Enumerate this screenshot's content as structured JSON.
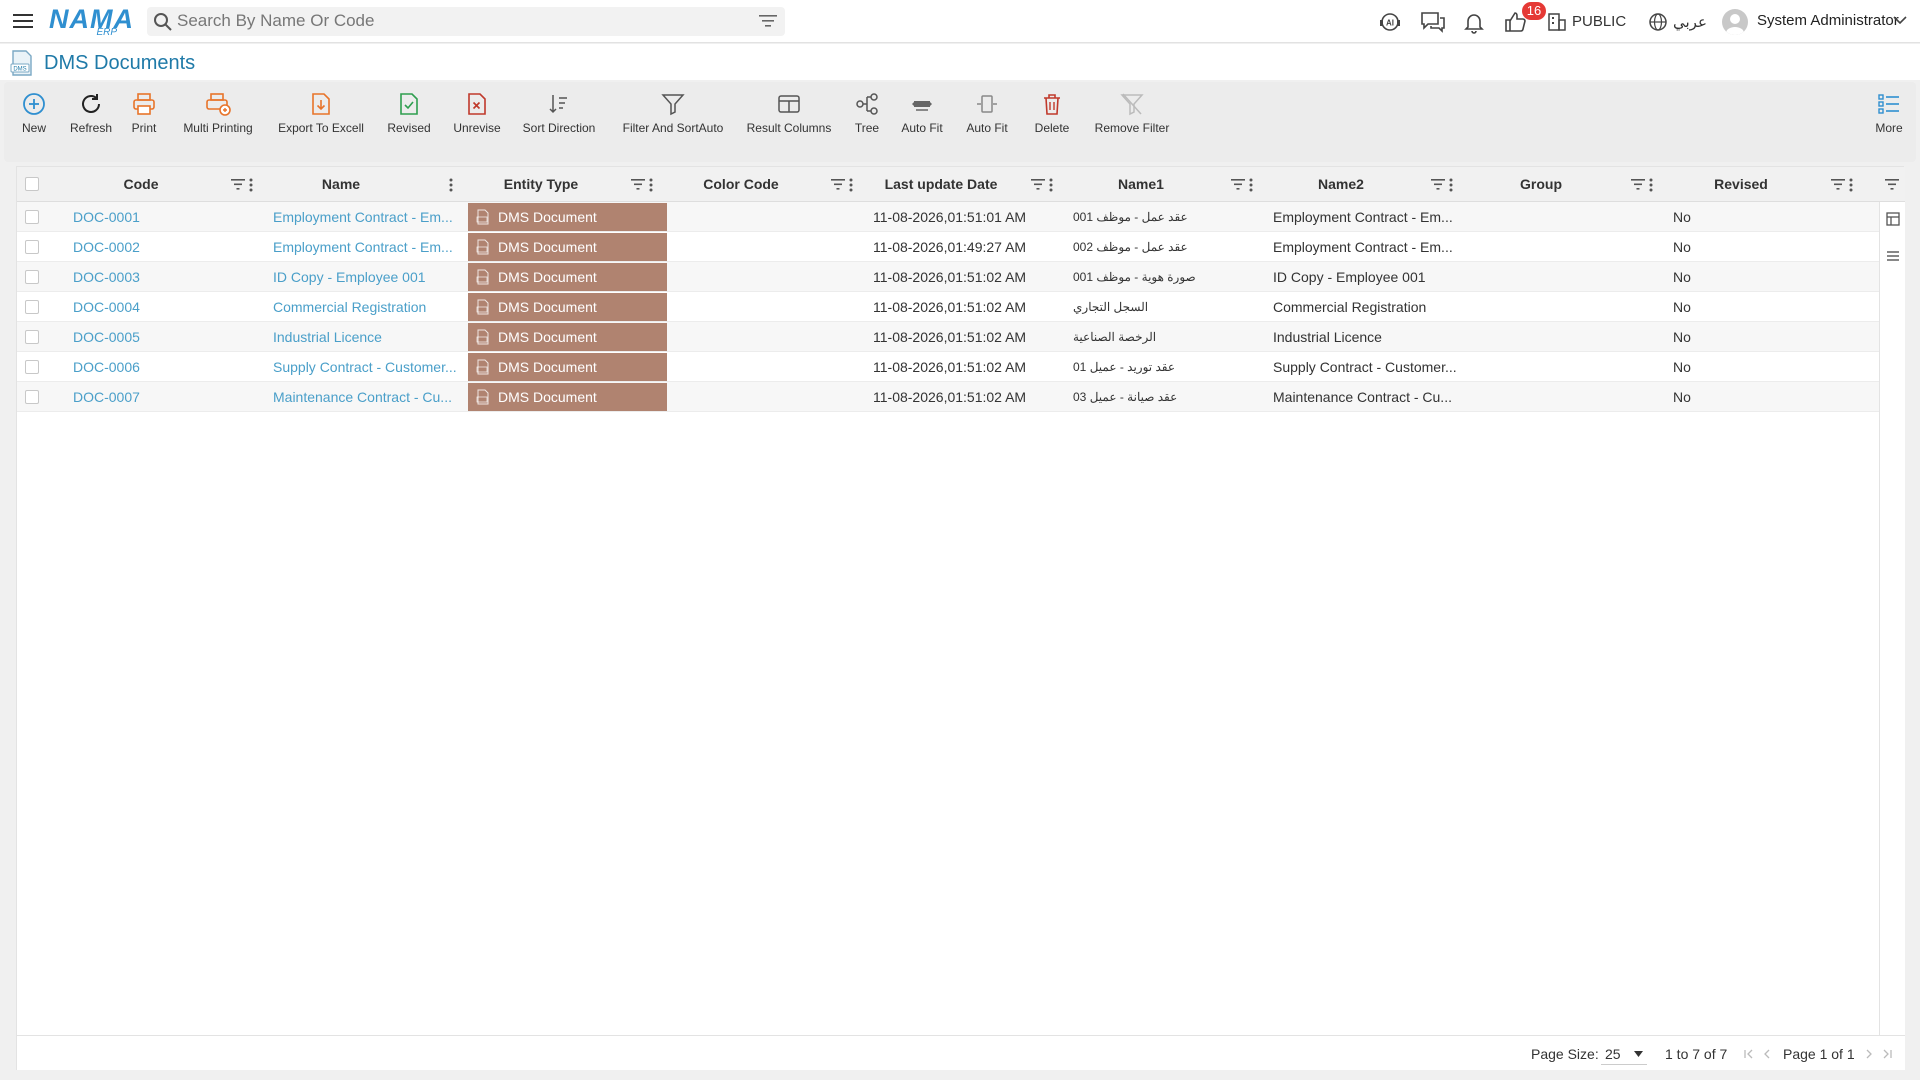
{
  "app": {
    "logo": "NAMA",
    "logo_sub": "ERP"
  },
  "search": {
    "placeholder": "Search By Name Or Code"
  },
  "header": {
    "badge_count": "16",
    "profile": "PUBLIC",
    "language": "عربي",
    "user": "System Administrator"
  },
  "page": {
    "title": "DMS Documents",
    "icon_label": "DMS"
  },
  "toolbar": {
    "new": "New",
    "refresh": "Refresh",
    "print": "Print",
    "multi_printing": "Multi Printing",
    "export": "Export To Excell",
    "revised": "Revised",
    "unrevise": "Unrevise",
    "sort_direction": "Sort Direction",
    "filter_sort": "Filter And SortAuto",
    "result_columns": "Result Columns",
    "tree": "Tree",
    "auto_fit_1": "Auto Fit",
    "auto_fit_2": "Auto Fit",
    "delete": "Delete",
    "remove_filter": "Remove Filter",
    "more": "More"
  },
  "columns": {
    "code": "Code",
    "name": "Name",
    "entity_type": "Entity Type",
    "color_code": "Color Code",
    "last_update": "Last update Date",
    "name1": "Name1",
    "name2": "Name2",
    "group": "Group",
    "revised": "Revised"
  },
  "rows": [
    {
      "code": "DOC-0001",
      "name": "Employment Contract - Em...",
      "entity_type": "DMS Document",
      "color_code": "",
      "last_update": "11-08-2026,01:51:01 AM",
      "name1": "عقد عمل - موظف 001",
      "name2": "Employment Contract - Em...",
      "group": "",
      "revised": "No"
    },
    {
      "code": "DOC-0002",
      "name": "Employment Contract - Em...",
      "entity_type": "DMS Document",
      "color_code": "",
      "last_update": "11-08-2026,01:49:27 AM",
      "name1": "عقد عمل - موظف 002",
      "name2": "Employment Contract - Em...",
      "group": "",
      "revised": "No"
    },
    {
      "code": "DOC-0003",
      "name": "ID Copy - Employee 001",
      "entity_type": "DMS Document",
      "color_code": "",
      "last_update": "11-08-2026,01:51:02 AM",
      "name1": "صورة هوية - موظف 001",
      "name2": "ID Copy - Employee 001",
      "group": "",
      "revised": "No"
    },
    {
      "code": "DOC-0004",
      "name": "Commercial Registration",
      "entity_type": "DMS Document",
      "color_code": "",
      "last_update": "11-08-2026,01:51:02 AM",
      "name1": "السجل التجاري",
      "name2": "Commercial Registration",
      "group": "",
      "revised": "No"
    },
    {
      "code": "DOC-0005",
      "name": "Industrial Licence",
      "entity_type": "DMS Document",
      "color_code": "",
      "last_update": "11-08-2026,01:51:02 AM",
      "name1": "الرخصة الصناعية",
      "name2": "Industrial Licence",
      "group": "",
      "revised": "No"
    },
    {
      "code": "DOC-0006",
      "name": "Supply Contract - Customer...",
      "entity_type": "DMS Document",
      "color_code": "",
      "last_update": "11-08-2026,01:51:02 AM",
      "name1": "عقد توريد - عميل 01",
      "name2": "Supply Contract - Customer...",
      "group": "",
      "revised": "No"
    },
    {
      "code": "DOC-0007",
      "name": "Maintenance Contract - Cu...",
      "entity_type": "DMS Document",
      "color_code": "",
      "last_update": "11-08-2026,01:51:02 AM",
      "name1": "عقد صيانة - عميل 03",
      "name2": "Maintenance Contract - Cu...",
      "group": "",
      "revised": "No"
    }
  ],
  "footer": {
    "page_size_label": "Page Size:",
    "page_size": "25",
    "range": "1 to 7 of 7",
    "page_info": "Page 1 of 1"
  },
  "colors": {
    "accent": "#1f7aa8",
    "link": "#4a9fc9",
    "entity_bg": "#b08370",
    "badge": "#e53935"
  }
}
